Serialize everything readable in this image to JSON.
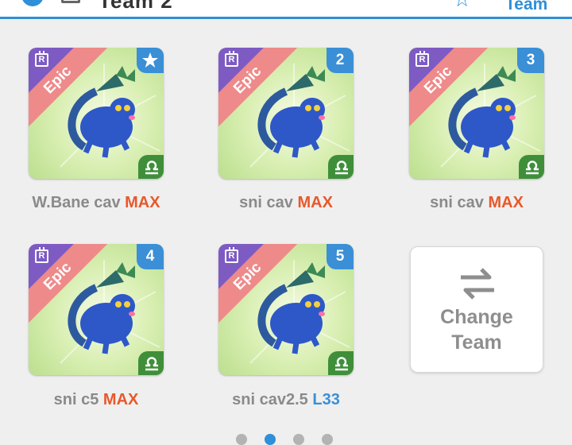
{
  "header": {
    "title": "Team 2",
    "team_label": "Team",
    "accent_color": "#2f8fd8"
  },
  "cards": [
    {
      "name": "W.Bane cav",
      "level": "MAX",
      "level_kind": "max",
      "rarity": "Epic",
      "rarity_badge": "R",
      "slot": "",
      "slot_icon": "star-icon",
      "element_icon": "libra-icon"
    },
    {
      "name": "sni cav",
      "level": "MAX",
      "level_kind": "max",
      "rarity": "Epic",
      "rarity_badge": "R",
      "slot": "2",
      "element_icon": "libra-icon"
    },
    {
      "name": "sni cav",
      "level": "MAX",
      "level_kind": "max",
      "rarity": "Epic",
      "rarity_badge": "R",
      "slot": "3",
      "element_icon": "libra-icon"
    },
    {
      "name": "sni c5",
      "level": "MAX",
      "level_kind": "max",
      "rarity": "Epic",
      "rarity_badge": "R",
      "slot": "4",
      "element_icon": "libra-icon"
    },
    {
      "name": "sni cav2.5",
      "level": "L33",
      "level_kind": "number",
      "rarity": "Epic",
      "rarity_badge": "R",
      "slot": "5",
      "element_icon": "libra-icon"
    }
  ],
  "change_team": {
    "line1": "Change",
    "line2": "Team",
    "icon": "swap-arrows-icon"
  },
  "pagination": {
    "total": 4,
    "active_index": 1
  }
}
